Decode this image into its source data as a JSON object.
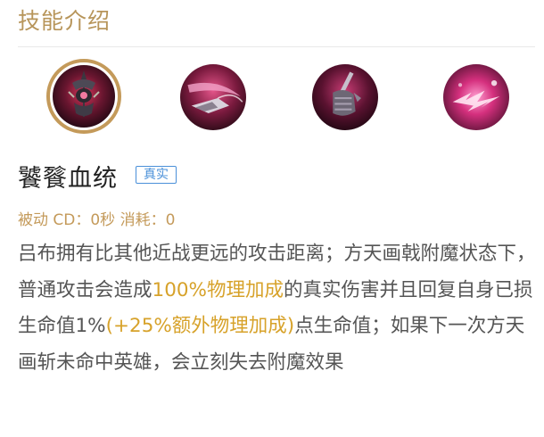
{
  "header": {
    "title": "技能介绍"
  },
  "skills": [
    {
      "icon": "halberd-skill-icon",
      "selected": true
    },
    {
      "icon": "slash-skill-icon",
      "selected": false
    },
    {
      "icon": "gauntlet-skill-icon",
      "selected": false
    },
    {
      "icon": "burst-skill-icon",
      "selected": false
    }
  ],
  "detail": {
    "name": "饕餮血统",
    "tag": "真实",
    "meta": "被动 CD：0秒 消耗：0",
    "desc_1": "吕布拥有比其他近战更远的攻击距离；方天画戟附魔状态下，普通攻击会造成",
    "desc_hl_1": "100%物理加成",
    "desc_2": "的真实伤害并且回复自身已损生命值1%",
    "desc_hl_2": "(+25%额外物理加成)",
    "desc_3": "点生命值；如果下一次方天画斩未命中英雄，会立刻失去附魔效果"
  },
  "colors": {
    "accent": "#b7955a",
    "highlight": "#d7a22a",
    "tag": "#4a90d9"
  }
}
